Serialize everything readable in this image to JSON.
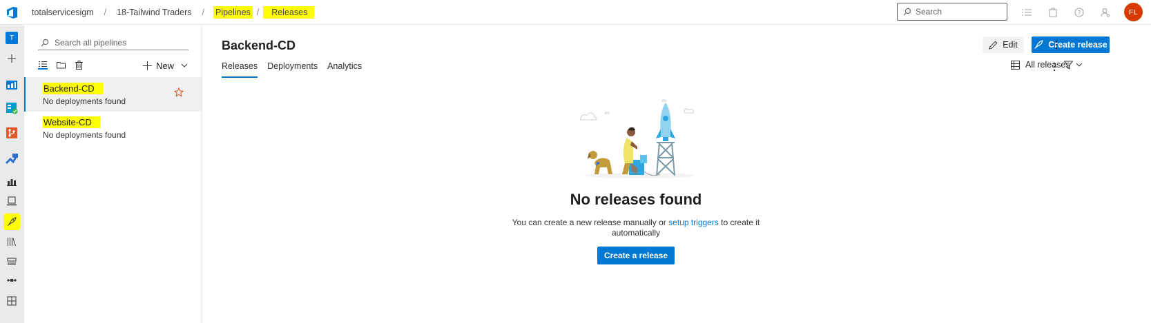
{
  "breadcrumbs": [
    "totalservicesigm",
    "18-Tailwind Traders",
    "Pipelines",
    "Releases"
  ],
  "search": {
    "placeholder": "Search"
  },
  "user": {
    "initials": "FL"
  },
  "rail": {
    "org_initial": "T"
  },
  "panel": {
    "search_placeholder": "Search all pipelines",
    "new_label": "New",
    "pipelines": [
      {
        "name": "Backend-CD",
        "status": "No deployments found",
        "selected": true
      },
      {
        "name": "Website-CD",
        "status": "No deployments found",
        "selected": false
      }
    ]
  },
  "main": {
    "title": "Backend-CD",
    "tabs": [
      "Releases",
      "Deployments",
      "Analytics"
    ],
    "active_tab": "Releases",
    "edit_label": "Edit",
    "create_release_label": "Create release",
    "filter_label": "All releases",
    "empty": {
      "title": "No releases found",
      "desc_prefix": "You can create a new release manually or ",
      "desc_link": "setup triggers",
      "desc_suffix": " to create it automatically",
      "button_label": "Create a release"
    }
  },
  "colors": {
    "accent": "#0078d4",
    "highlight": "#ffff00",
    "avatar": "#d83b01"
  }
}
